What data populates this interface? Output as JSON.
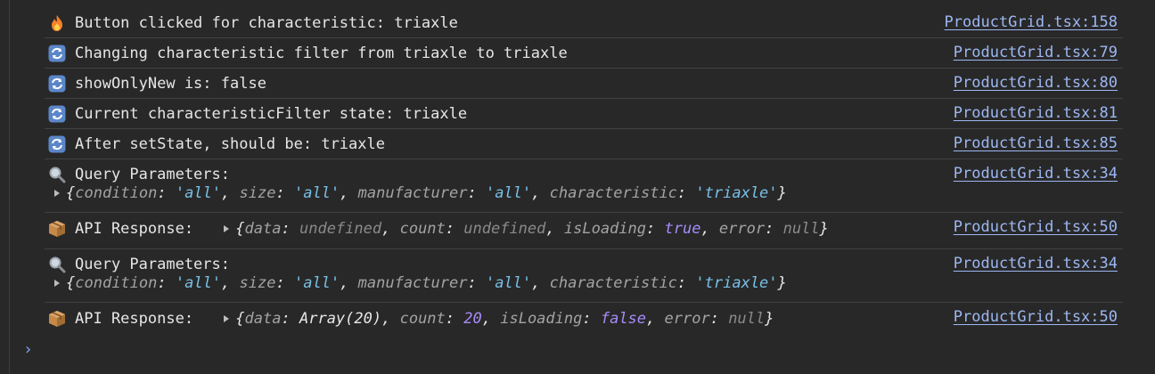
{
  "rows": [
    {
      "icon": "fire-icon",
      "text": "Button clicked for characteristic: triaxle",
      "src": "ProductGrid.tsx:158"
    },
    {
      "icon": "refresh-icon",
      "text": "Changing characteristic filter from triaxle to triaxle",
      "src": "ProductGrid.tsx:79"
    },
    {
      "icon": "refresh-icon",
      "text": "showOnlyNew is: ",
      "value": "false",
      "src": "ProductGrid.tsx:80"
    },
    {
      "icon": "refresh-icon",
      "text": "Current characteristicFilter state: triaxle",
      "src": "ProductGrid.tsx:81"
    },
    {
      "icon": "refresh-icon",
      "text": "After setState, should be: triaxle",
      "src": "ProductGrid.tsx:85"
    },
    {
      "icon": "magnifier-icon",
      "text": "Query Parameters:",
      "src": "ProductGrid.tsx:34",
      "object": {
        "condition": "'all'",
        "size": "'all'",
        "manufacturer": "'all'",
        "characteristic": "'triaxle'"
      }
    },
    {
      "icon": "package-icon",
      "text": "API Response: ",
      "src": "ProductGrid.tsx:50",
      "object": {
        "data": "undefined",
        "count": "undefined",
        "isLoading": "true",
        "error": "null"
      }
    },
    {
      "icon": "magnifier-icon",
      "text": "Query Parameters:",
      "src": "ProductGrid.tsx:34",
      "object": {
        "condition": "'all'",
        "size": "'all'",
        "manufacturer": "'all'",
        "characteristic": "'triaxle'"
      }
    },
    {
      "icon": "package-icon",
      "text": "API Response: ",
      "src": "ProductGrid.tsx:50",
      "object": {
        "data": "Array(20)",
        "count": "20",
        "isLoading": "false",
        "error": "null"
      }
    }
  ],
  "prompt": "›"
}
